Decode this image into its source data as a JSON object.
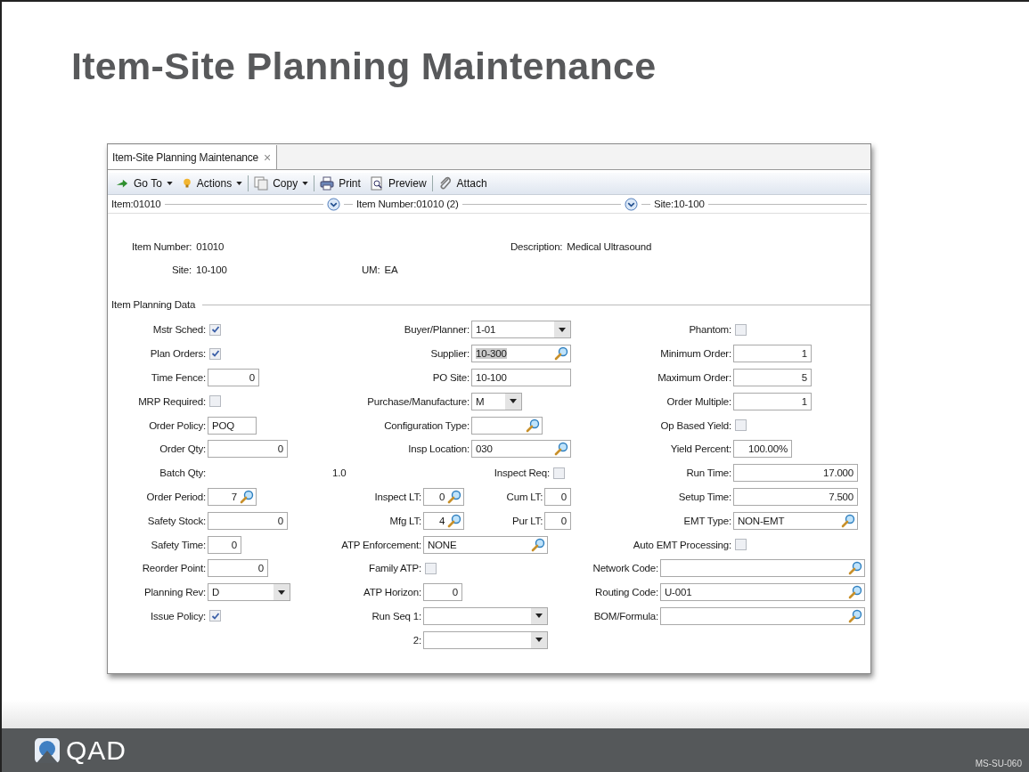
{
  "slide": {
    "title": "Item-Site Planning Maintenance"
  },
  "window": {
    "tab": {
      "label": "Item-Site Planning Maintenance",
      "close": "×",
      "selected": true
    },
    "toolbar": [
      {
        "label": "Go To",
        "kind": "navigate",
        "has_menu": true
      },
      {
        "label": "Actions",
        "kind": "actions",
        "has_menu": true
      },
      {
        "label": "Copy",
        "kind": "copy",
        "has_menu": true
      },
      {
        "label": "Print",
        "kind": "print",
        "has_menu": false
      },
      {
        "label": "Preview",
        "kind": "preview",
        "has_menu": false
      },
      {
        "label": "Attach",
        "kind": "attach",
        "has_menu": false
      }
    ],
    "breadcrumbs": [
      {
        "text": "Item:01010",
        "expandable": true
      },
      {
        "text": "Item Number:01010 (2)",
        "expandable": true
      },
      {
        "text": "Site:10-100",
        "expandable": false
      }
    ],
    "header": [
      {
        "label": "Item Number:",
        "value": "01010"
      },
      {
        "label": "Description:",
        "value": "Medical Ultrasound"
      },
      {
        "label": "Site:",
        "value": "10-100"
      },
      {
        "label": "UM:",
        "value": "EA"
      }
    ],
    "section": "Item Planning Data",
    "columns": [
      [
        {
          "label": "Mstr Sched:",
          "kind": "check",
          "checked": true
        },
        {
          "label": "Plan Orders:",
          "kind": "check",
          "checked": true
        },
        {
          "label": "Time Fence:",
          "kind": "number",
          "value": "0"
        },
        {
          "label": "MRP Required:",
          "kind": "check",
          "checked": false
        },
        {
          "label": "Order Policy:",
          "kind": "text",
          "value": "POQ"
        },
        {
          "label": "Order Qty:",
          "kind": "number",
          "value": "0"
        },
        {
          "label": "Batch Qty:",
          "kind": "readonly",
          "value": "1.0"
        },
        {
          "label": "Order Period:",
          "kind": "numlookup",
          "value": "7"
        },
        {
          "label": "Safety Stock:",
          "kind": "number",
          "value": "0"
        },
        {
          "label": "Safety Time:",
          "kind": "number",
          "value": "0"
        },
        {
          "label": "Reorder Point:",
          "kind": "number",
          "value": "0"
        },
        {
          "label": "Planning Rev:",
          "kind": "select",
          "value": "D"
        },
        {
          "label": "Issue Policy:",
          "kind": "check",
          "checked": true
        }
      ],
      [
        {
          "label": "Buyer/Planner:",
          "kind": "select",
          "value": "1-01"
        },
        {
          "label": "Supplier:",
          "kind": "lookup",
          "value": "10-300",
          "highlighted": true
        },
        {
          "label": "PO Site:",
          "kind": "text",
          "value": "10-100"
        },
        {
          "label": "Purchase/Manufacture:",
          "kind": "select",
          "value": "M"
        },
        {
          "label": "Configuration Type:",
          "kind": "lookup"
        },
        {
          "label": "Insp Location:",
          "kind": "lookup",
          "value": "030"
        },
        {
          "label": "Inspect Req:",
          "kind": "check",
          "checked": false
        },
        {
          "label": "Inspect LT:",
          "kind": "numlookup",
          "value": "0",
          "extra": {
            "label": "Cum LT:",
            "value": "0"
          }
        },
        {
          "label": "Mfg LT:",
          "kind": "numlookup",
          "value": "4",
          "extra": {
            "label": "Pur LT:",
            "value": "0"
          }
        },
        {
          "label": "ATP Enforcement:",
          "kind": "lookup",
          "value": "NONE"
        },
        {
          "label": "Family ATP:",
          "kind": "check",
          "checked": false
        },
        {
          "label": "ATP Horizon:",
          "kind": "number",
          "value": "0"
        },
        {
          "label": "Run Seq 1:",
          "kind": "select"
        },
        {
          "label": "2:",
          "kind": "select"
        }
      ],
      [
        {
          "label": "Phantom:",
          "kind": "check",
          "checked": false
        },
        {
          "label": "Minimum Order:",
          "kind": "number",
          "value": "1"
        },
        {
          "label": "Maximum Order:",
          "kind": "number",
          "value": "5"
        },
        {
          "label": "Order Multiple:",
          "kind": "number",
          "value": "1"
        },
        {
          "label": "Op Based Yield:",
          "kind": "check",
          "checked": false
        },
        {
          "label": "Yield Percent:",
          "kind": "number",
          "value": "100.00%"
        },
        {
          "label": "Run Time:",
          "kind": "number",
          "value": "17.000"
        },
        {
          "label": "Setup Time:",
          "kind": "number",
          "value": "7.500"
        },
        {
          "label": "EMT Type:",
          "kind": "lookup",
          "value": "NON-EMT"
        },
        {
          "label": "Auto EMT Processing:",
          "kind": "check",
          "checked": false
        },
        {
          "label": "Network Code:",
          "kind": "lookup"
        },
        {
          "label": "Routing Code:",
          "kind": "lookup",
          "value": "U-001"
        },
        {
          "label": "BOM/Formula:",
          "kind": "lookup"
        }
      ]
    ]
  },
  "footer": {
    "logo": "QAD",
    "code": "MS-SU-060"
  }
}
